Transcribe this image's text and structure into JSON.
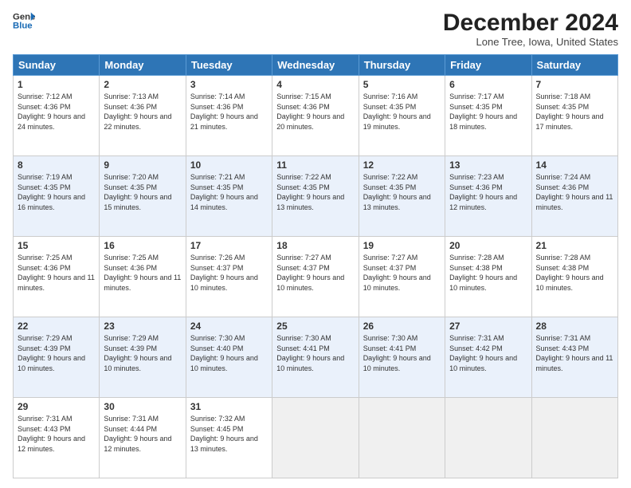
{
  "header": {
    "logo_line1": "General",
    "logo_line2": "Blue",
    "month_title": "December 2024",
    "location": "Lone Tree, Iowa, United States"
  },
  "weekdays": [
    "Sunday",
    "Monday",
    "Tuesday",
    "Wednesday",
    "Thursday",
    "Friday",
    "Saturday"
  ],
  "weeks": [
    [
      {
        "day": "1",
        "sunrise": "Sunrise: 7:12 AM",
        "sunset": "Sunset: 4:36 PM",
        "daylight": "Daylight: 9 hours and 24 minutes."
      },
      {
        "day": "2",
        "sunrise": "Sunrise: 7:13 AM",
        "sunset": "Sunset: 4:36 PM",
        "daylight": "Daylight: 9 hours and 22 minutes."
      },
      {
        "day": "3",
        "sunrise": "Sunrise: 7:14 AM",
        "sunset": "Sunset: 4:36 PM",
        "daylight": "Daylight: 9 hours and 21 minutes."
      },
      {
        "day": "4",
        "sunrise": "Sunrise: 7:15 AM",
        "sunset": "Sunset: 4:36 PM",
        "daylight": "Daylight: 9 hours and 20 minutes."
      },
      {
        "day": "5",
        "sunrise": "Sunrise: 7:16 AM",
        "sunset": "Sunset: 4:35 PM",
        "daylight": "Daylight: 9 hours and 19 minutes."
      },
      {
        "day": "6",
        "sunrise": "Sunrise: 7:17 AM",
        "sunset": "Sunset: 4:35 PM",
        "daylight": "Daylight: 9 hours and 18 minutes."
      },
      {
        "day": "7",
        "sunrise": "Sunrise: 7:18 AM",
        "sunset": "Sunset: 4:35 PM",
        "daylight": "Daylight: 9 hours and 17 minutes."
      }
    ],
    [
      {
        "day": "8",
        "sunrise": "Sunrise: 7:19 AM",
        "sunset": "Sunset: 4:35 PM",
        "daylight": "Daylight: 9 hours and 16 minutes."
      },
      {
        "day": "9",
        "sunrise": "Sunrise: 7:20 AM",
        "sunset": "Sunset: 4:35 PM",
        "daylight": "Daylight: 9 hours and 15 minutes."
      },
      {
        "day": "10",
        "sunrise": "Sunrise: 7:21 AM",
        "sunset": "Sunset: 4:35 PM",
        "daylight": "Daylight: 9 hours and 14 minutes."
      },
      {
        "day": "11",
        "sunrise": "Sunrise: 7:22 AM",
        "sunset": "Sunset: 4:35 PM",
        "daylight": "Daylight: 9 hours and 13 minutes."
      },
      {
        "day": "12",
        "sunrise": "Sunrise: 7:22 AM",
        "sunset": "Sunset: 4:35 PM",
        "daylight": "Daylight: 9 hours and 13 minutes."
      },
      {
        "day": "13",
        "sunrise": "Sunrise: 7:23 AM",
        "sunset": "Sunset: 4:36 PM",
        "daylight": "Daylight: 9 hours and 12 minutes."
      },
      {
        "day": "14",
        "sunrise": "Sunrise: 7:24 AM",
        "sunset": "Sunset: 4:36 PM",
        "daylight": "Daylight: 9 hours and 11 minutes."
      }
    ],
    [
      {
        "day": "15",
        "sunrise": "Sunrise: 7:25 AM",
        "sunset": "Sunset: 4:36 PM",
        "daylight": "Daylight: 9 hours and 11 minutes."
      },
      {
        "day": "16",
        "sunrise": "Sunrise: 7:25 AM",
        "sunset": "Sunset: 4:36 PM",
        "daylight": "Daylight: 9 hours and 11 minutes."
      },
      {
        "day": "17",
        "sunrise": "Sunrise: 7:26 AM",
        "sunset": "Sunset: 4:37 PM",
        "daylight": "Daylight: 9 hours and 10 minutes."
      },
      {
        "day": "18",
        "sunrise": "Sunrise: 7:27 AM",
        "sunset": "Sunset: 4:37 PM",
        "daylight": "Daylight: 9 hours and 10 minutes."
      },
      {
        "day": "19",
        "sunrise": "Sunrise: 7:27 AM",
        "sunset": "Sunset: 4:37 PM",
        "daylight": "Daylight: 9 hours and 10 minutes."
      },
      {
        "day": "20",
        "sunrise": "Sunrise: 7:28 AM",
        "sunset": "Sunset: 4:38 PM",
        "daylight": "Daylight: 9 hours and 10 minutes."
      },
      {
        "day": "21",
        "sunrise": "Sunrise: 7:28 AM",
        "sunset": "Sunset: 4:38 PM",
        "daylight": "Daylight: 9 hours and 10 minutes."
      }
    ],
    [
      {
        "day": "22",
        "sunrise": "Sunrise: 7:29 AM",
        "sunset": "Sunset: 4:39 PM",
        "daylight": "Daylight: 9 hours and 10 minutes."
      },
      {
        "day": "23",
        "sunrise": "Sunrise: 7:29 AM",
        "sunset": "Sunset: 4:39 PM",
        "daylight": "Daylight: 9 hours and 10 minutes."
      },
      {
        "day": "24",
        "sunrise": "Sunrise: 7:30 AM",
        "sunset": "Sunset: 4:40 PM",
        "daylight": "Daylight: 9 hours and 10 minutes."
      },
      {
        "day": "25",
        "sunrise": "Sunrise: 7:30 AM",
        "sunset": "Sunset: 4:41 PM",
        "daylight": "Daylight: 9 hours and 10 minutes."
      },
      {
        "day": "26",
        "sunrise": "Sunrise: 7:30 AM",
        "sunset": "Sunset: 4:41 PM",
        "daylight": "Daylight: 9 hours and 10 minutes."
      },
      {
        "day": "27",
        "sunrise": "Sunrise: 7:31 AM",
        "sunset": "Sunset: 4:42 PM",
        "daylight": "Daylight: 9 hours and 10 minutes."
      },
      {
        "day": "28",
        "sunrise": "Sunrise: 7:31 AM",
        "sunset": "Sunset: 4:43 PM",
        "daylight": "Daylight: 9 hours and 11 minutes."
      }
    ],
    [
      {
        "day": "29",
        "sunrise": "Sunrise: 7:31 AM",
        "sunset": "Sunset: 4:43 PM",
        "daylight": "Daylight: 9 hours and 12 minutes."
      },
      {
        "day": "30",
        "sunrise": "Sunrise: 7:31 AM",
        "sunset": "Sunset: 4:44 PM",
        "daylight": "Daylight: 9 hours and 12 minutes."
      },
      {
        "day": "31",
        "sunrise": "Sunrise: 7:32 AM",
        "sunset": "Sunset: 4:45 PM",
        "daylight": "Daylight: 9 hours and 13 minutes."
      },
      null,
      null,
      null,
      null
    ]
  ]
}
